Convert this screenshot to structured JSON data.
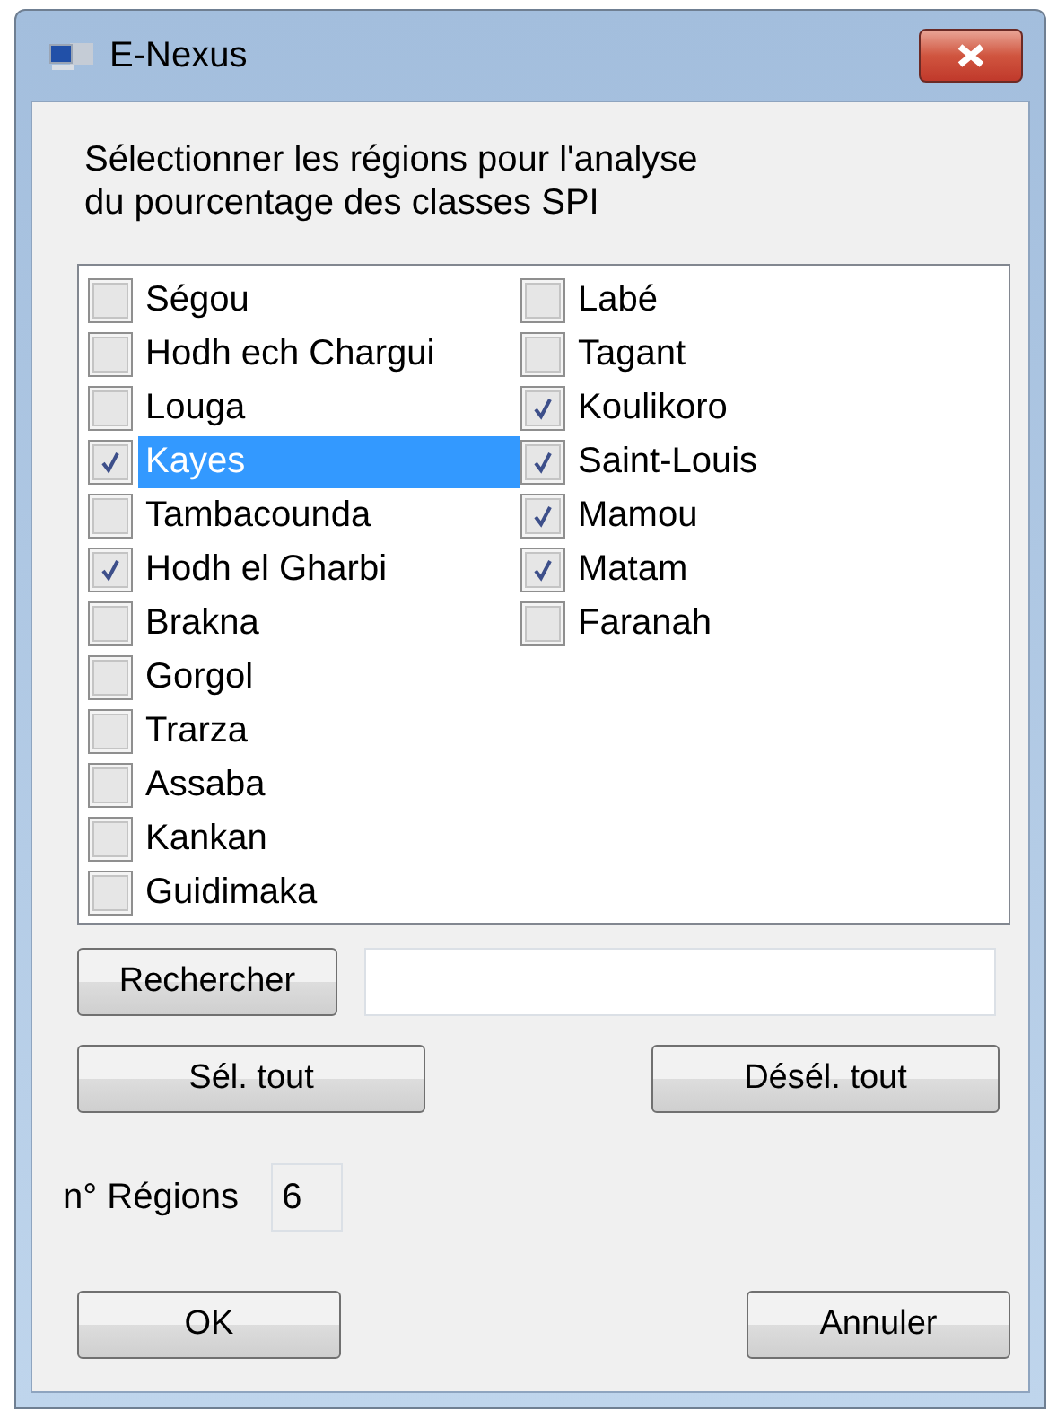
{
  "window": {
    "title": "E-Nexus"
  },
  "instruction": "Sélectionner les régions pour l'analyse\ndu pourcentage des classes SPI",
  "regions": [
    {
      "label": "Ségou",
      "checked": false,
      "selected": false
    },
    {
      "label": "Hodh ech Chargui",
      "checked": false,
      "selected": false
    },
    {
      "label": "Louga",
      "checked": false,
      "selected": false
    },
    {
      "label": "Kayes",
      "checked": true,
      "selected": true
    },
    {
      "label": "Tambacounda",
      "checked": false,
      "selected": false
    },
    {
      "label": "Hodh el Gharbi",
      "checked": true,
      "selected": false
    },
    {
      "label": "Brakna",
      "checked": false,
      "selected": false
    },
    {
      "label": "Gorgol",
      "checked": false,
      "selected": false
    },
    {
      "label": "Trarza",
      "checked": false,
      "selected": false
    },
    {
      "label": "Assaba",
      "checked": false,
      "selected": false
    },
    {
      "label": "Kankan",
      "checked": false,
      "selected": false
    },
    {
      "label": "Guidimaka",
      "checked": false,
      "selected": false
    },
    {
      "label": "Labé",
      "checked": false,
      "selected": false
    },
    {
      "label": "Tagant",
      "checked": false,
      "selected": false
    },
    {
      "label": "Koulikoro",
      "checked": true,
      "selected": false
    },
    {
      "label": "Saint-Louis",
      "checked": true,
      "selected": false
    },
    {
      "label": "Mamou",
      "checked": true,
      "selected": false
    },
    {
      "label": "Matam",
      "checked": true,
      "selected": false
    },
    {
      "label": "Faranah",
      "checked": false,
      "selected": false
    }
  ],
  "search_button": "Rechercher",
  "select_all_button": "Sél. tout",
  "deselect_all_button": "Désél. tout",
  "count": {
    "label": "n° Régions",
    "value": "6"
  },
  "ok_button": "OK",
  "cancel_button": "Annuler"
}
